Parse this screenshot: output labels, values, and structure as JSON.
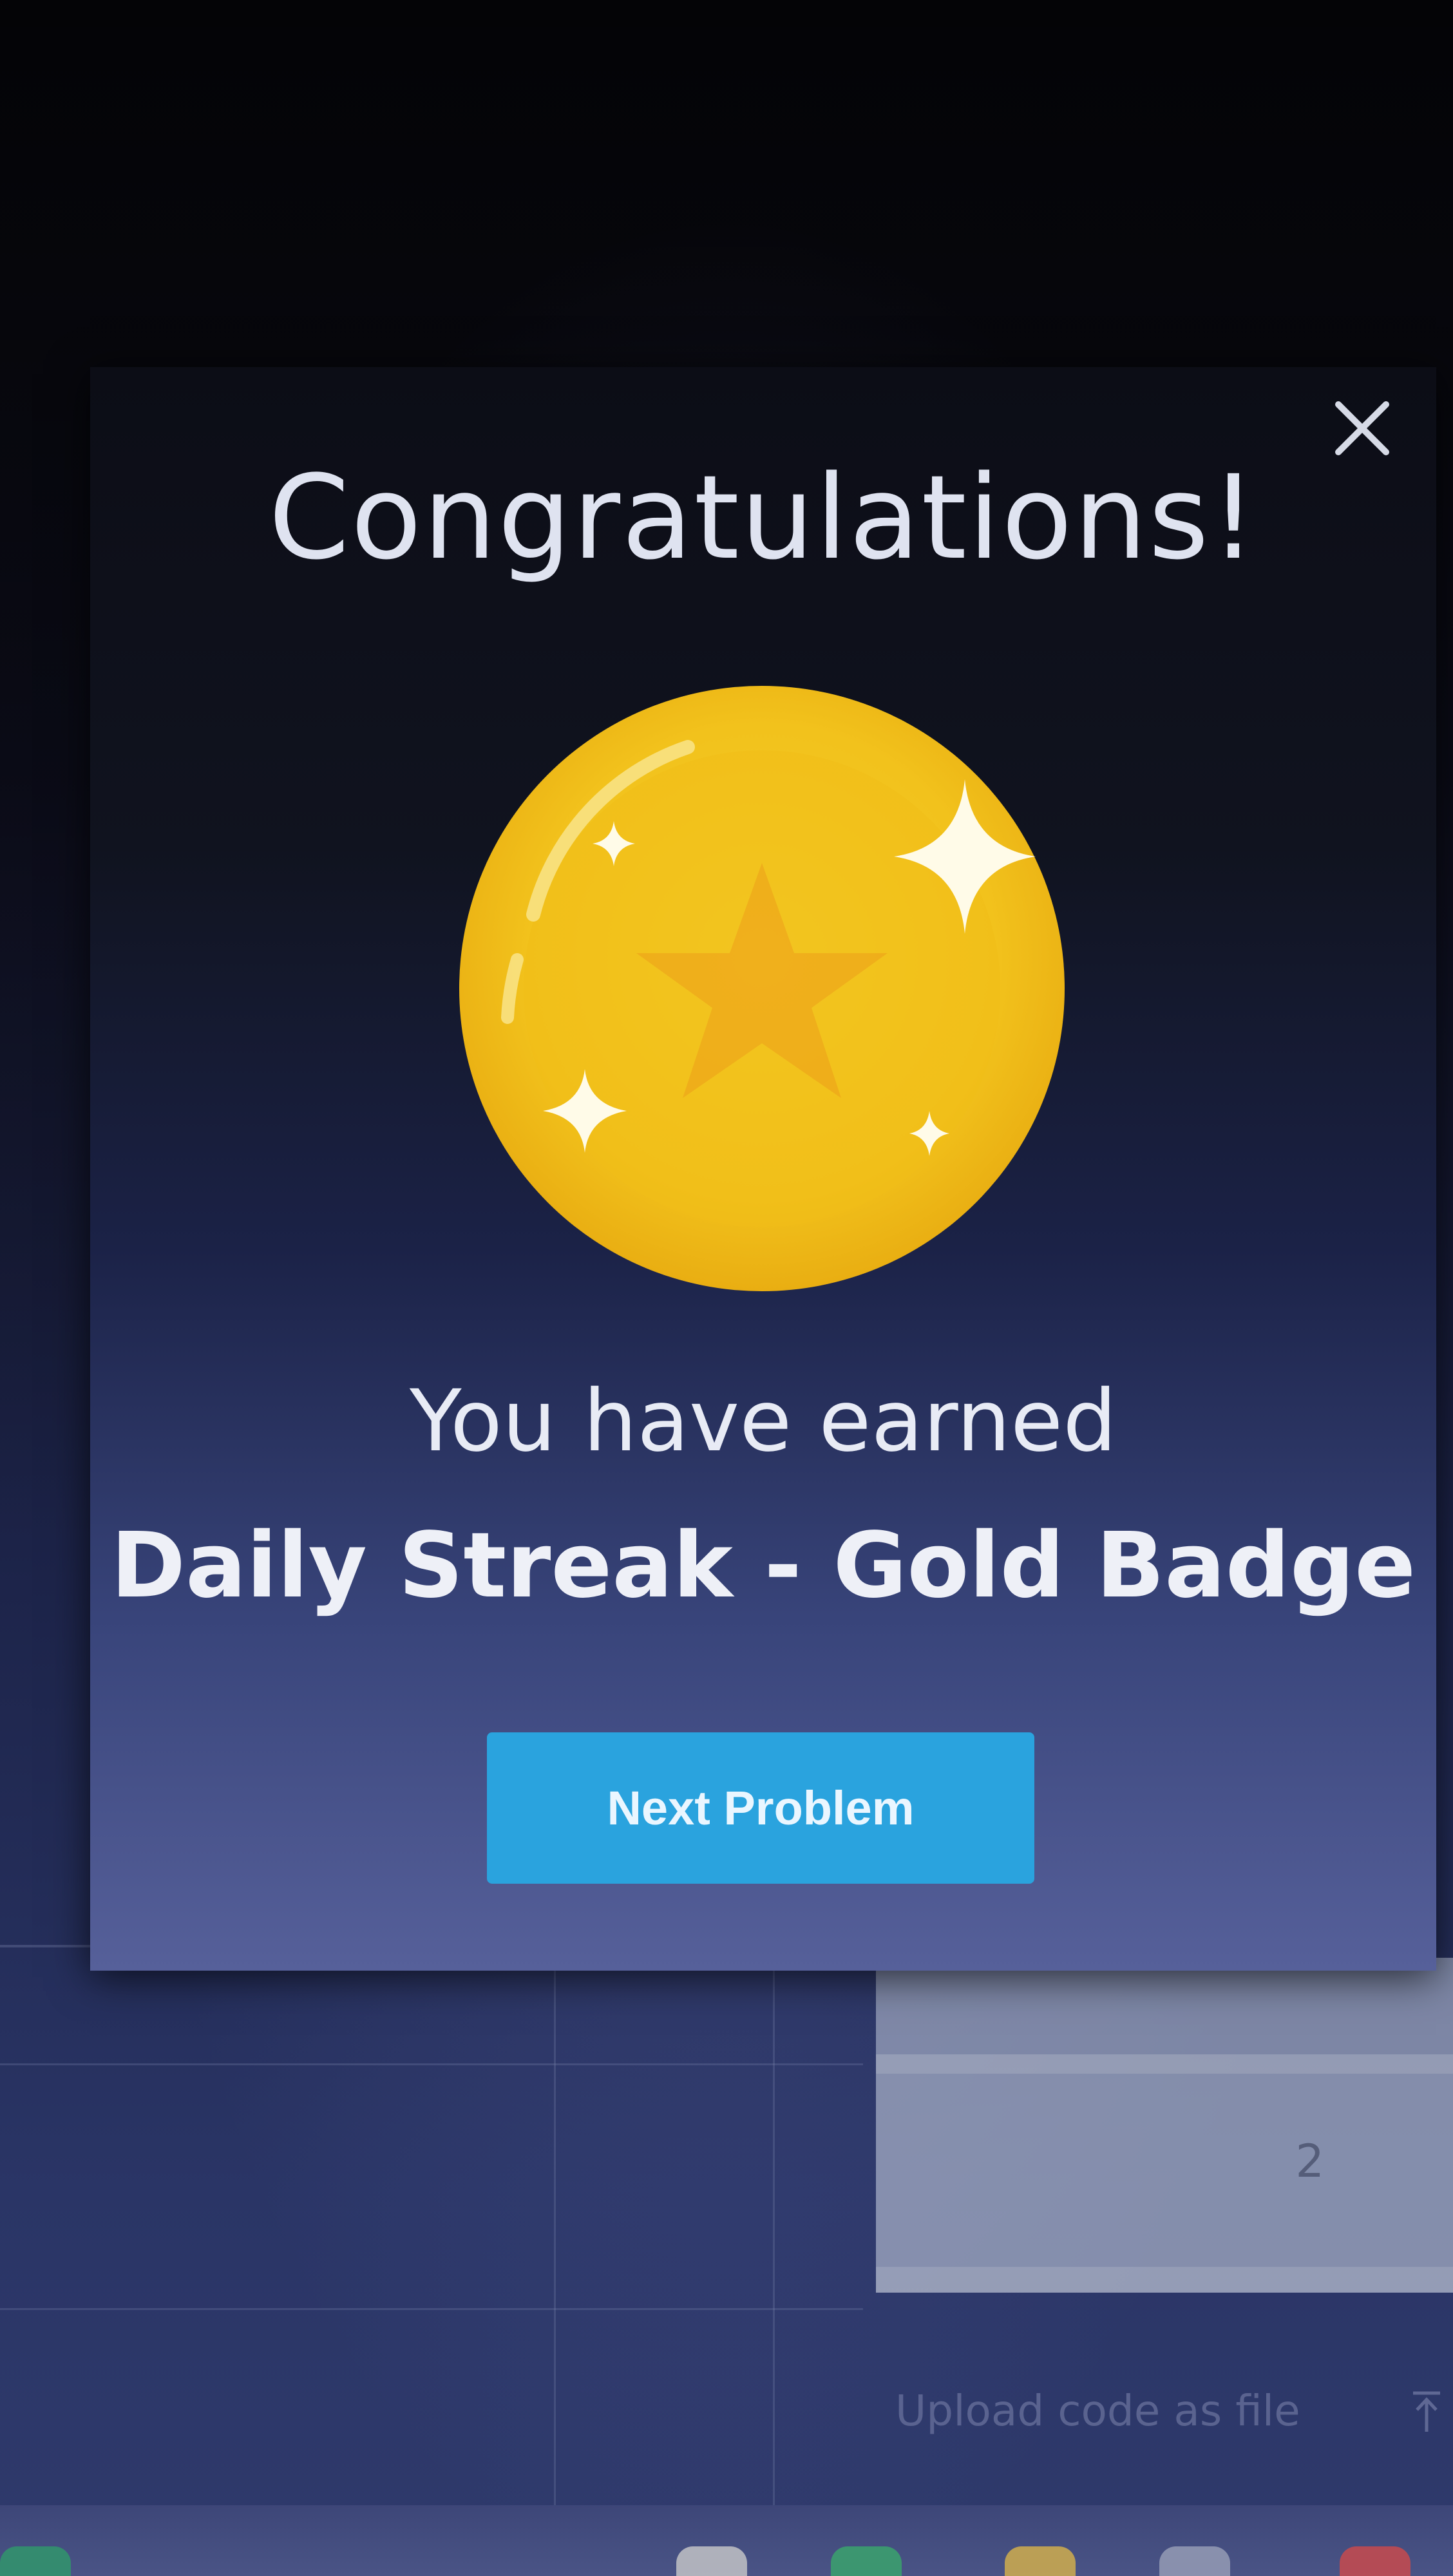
{
  "modal": {
    "title": "Congratulations!",
    "close_icon": "close-icon",
    "badge_icon": "gold-medal-icon",
    "earned_text": "You have earned",
    "badge_name": "Daily Streak - Gold Badge",
    "next_button_label": "Next Problem",
    "button_color": "#2aa3de"
  },
  "background": {
    "table_number": "2",
    "upload_label": "Upload code as file",
    "upload_icon": "upload-icon"
  }
}
